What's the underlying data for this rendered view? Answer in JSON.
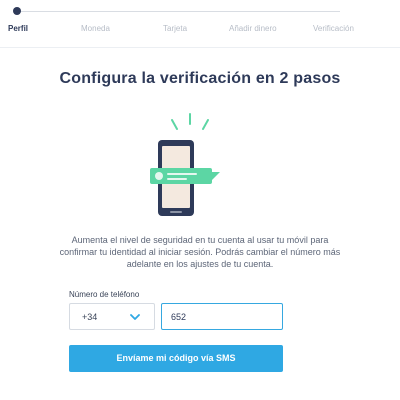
{
  "stepper": {
    "steps": [
      {
        "label": "Perfil",
        "active": true
      },
      {
        "label": "Moneda",
        "active": false
      },
      {
        "label": "Tarjeta",
        "active": false
      },
      {
        "label": "Añadir dinero",
        "active": false
      },
      {
        "label": "Verificación",
        "active": false
      }
    ]
  },
  "main": {
    "title": "Configura la verificación en 2 pasos",
    "illustration_icon": "phone-verification-icon",
    "description_lines": [
      "Aumenta el nivel de seguridad en tu cuenta al usar tu móvil para",
      "confirmar tu identidad al iniciar sesión. Podrás cambiar el número más",
      "adelante en los ajustes de tu cuenta."
    ]
  },
  "form": {
    "phone_label": "Número de teléfono",
    "country_code": "+34",
    "phone_value": "652",
    "submit_label": "Envíame mi código vía SMS"
  },
  "colors": {
    "accent": "#2fa8e3",
    "text_dark": "#2e3a59",
    "illustration_green": "#5cd6a4"
  }
}
